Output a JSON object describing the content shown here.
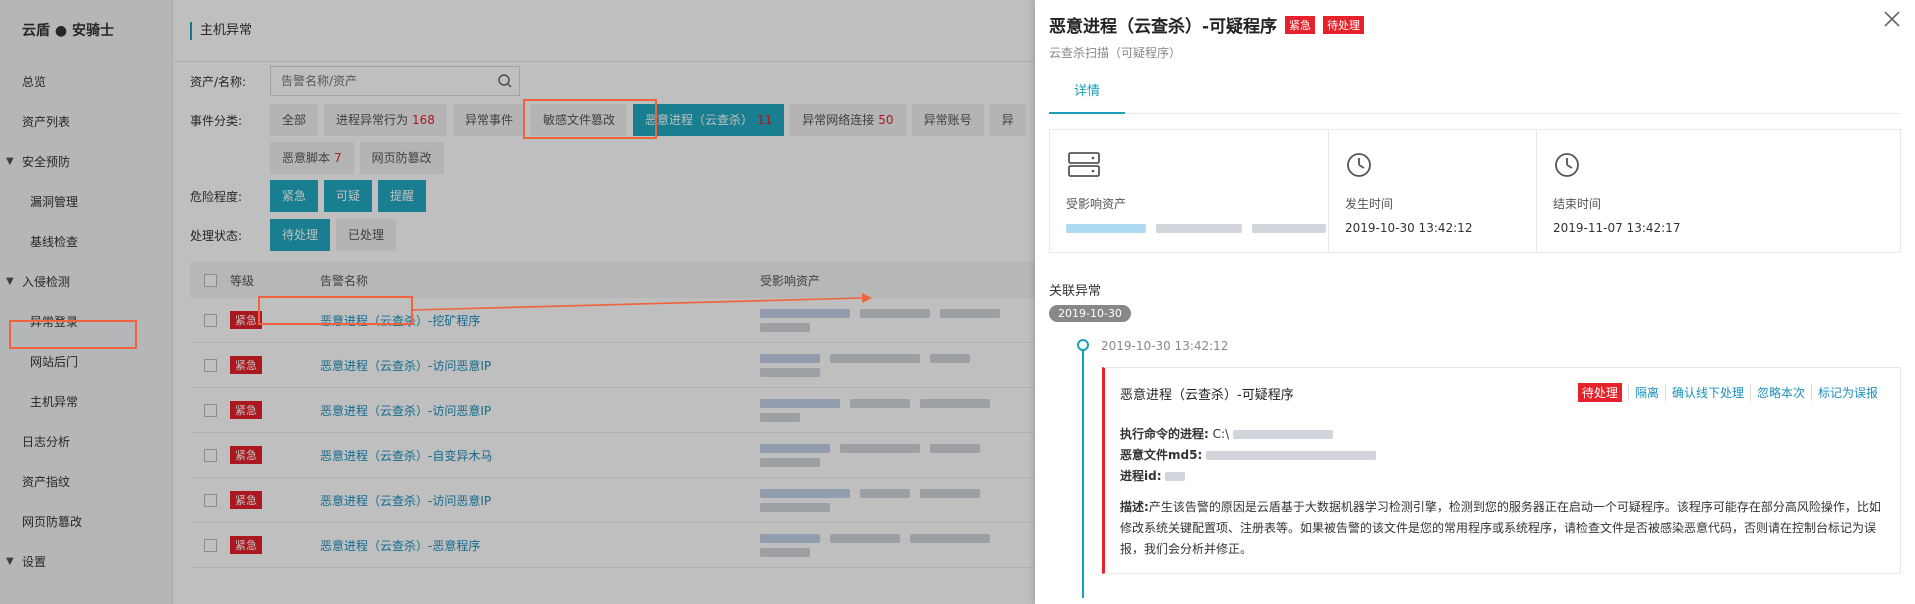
{
  "sidebar": {
    "brand": "云盾 ● 安骑士",
    "items": [
      {
        "label": "总览",
        "type": "item"
      },
      {
        "label": "资产列表",
        "type": "item"
      },
      {
        "label": "安全预防",
        "type": "group"
      },
      {
        "label": "漏洞管理",
        "type": "sub"
      },
      {
        "label": "基线检查",
        "type": "sub"
      },
      {
        "label": "入侵检测",
        "type": "group"
      },
      {
        "label": "异常登录",
        "type": "sub"
      },
      {
        "label": "网站后门",
        "type": "sub"
      },
      {
        "label": "主机异常",
        "type": "sub",
        "active": true
      },
      {
        "label": "日志分析",
        "type": "item"
      },
      {
        "label": "资产指纹",
        "type": "item"
      },
      {
        "label": "网页防篡改",
        "type": "item"
      },
      {
        "label": "设置",
        "type": "group"
      }
    ]
  },
  "main": {
    "title": "主机异常",
    "filters": {
      "asset_label": "资产/名称:",
      "search_placeholder": "告警名称/资产",
      "category_label": "事件分类:",
      "categories_row1": [
        {
          "label": "全部",
          "count": ""
        },
        {
          "label": "进程异常行为",
          "count": "168"
        },
        {
          "label": "异常事件",
          "count": ""
        },
        {
          "label": "敏感文件篡改",
          "count": ""
        },
        {
          "label": "恶意进程（云查杀）",
          "count": "11",
          "selected": true
        },
        {
          "label": "异常网络连接",
          "count": "50"
        },
        {
          "label": "异常账号",
          "count": ""
        },
        {
          "label": "异",
          "count": ""
        }
      ],
      "categories_row2": [
        {
          "label": "恶意脚本",
          "count": "7"
        },
        {
          "label": "网页防篡改",
          "count": ""
        }
      ],
      "risk_label": "危险程度:",
      "risk_options": [
        "紧急",
        "可疑",
        "提醒"
      ],
      "status_label": "处理状态:",
      "status_options": [
        {
          "label": "待处理",
          "selected": true
        },
        {
          "label": "已处理",
          "selected": false
        }
      ]
    },
    "table": {
      "headers": [
        "等级",
        "告警名称",
        "受影响资产"
      ],
      "rows": [
        {
          "level": "紧急",
          "name": "恶意进程（云查杀）-挖矿程序"
        },
        {
          "level": "紧急",
          "name": "恶意进程（云查杀）-访问恶意IP"
        },
        {
          "level": "紧急",
          "name": "恶意进程（云查杀）-访问恶意IP"
        },
        {
          "level": "紧急",
          "name": "恶意进程（云查杀）-自变异木马"
        },
        {
          "level": "紧急",
          "name": "恶意进程（云查杀）-访问恶意IP"
        },
        {
          "level": "紧急",
          "name": "恶意进程（云查杀）-恶意程序"
        }
      ]
    }
  },
  "drawer": {
    "title": "恶意进程（云查杀）-可疑程序",
    "tags": [
      "紧急",
      "待处理"
    ],
    "subtitle": "云查杀扫描（可疑程序）",
    "tab": "详情",
    "cards": [
      {
        "icon": "server-icon",
        "label": "受影响资产",
        "value": ""
      },
      {
        "icon": "clock-icon",
        "label": "发生时间",
        "value": "2019-10-30 13:42:12"
      },
      {
        "icon": "clock-icon",
        "label": "结束时间",
        "value": "2019-11-07 13:42:17"
      }
    ],
    "related_title": "关联异常",
    "date_pill": "2019-10-30",
    "event_time": "2019-10-30 13:42:12",
    "event": {
      "title": "恶意进程（云查杀）-可疑程序",
      "status": "待处理",
      "actions": [
        "隔离",
        "确认线下处理",
        "忽略本次",
        "标记为误报"
      ],
      "cmd_label": "执行命令的进程:",
      "cmd_value": "C:\\",
      "md5_label": "恶意文件md5:",
      "pid_label": "进程id:",
      "desc_label": "描述:",
      "desc_text": "产生该告警的原因是云盾基于大数据机器学习检测引擎，检测到您的服务器正在启动一个可疑程序。该程序可能存在部分高风险操作，比如修改系统关键配置项、注册表等。如果被告警的该文件是您的常用程序或系统程序，请检查文件是否被感染恶意代码，否则请在控制台标记为误报，我们会分析并修正。"
    }
  },
  "colors": {
    "accent": "#22a8c0",
    "danger": "#e6212a",
    "link": "#1a8fbd",
    "highlight": "#f0633c"
  }
}
